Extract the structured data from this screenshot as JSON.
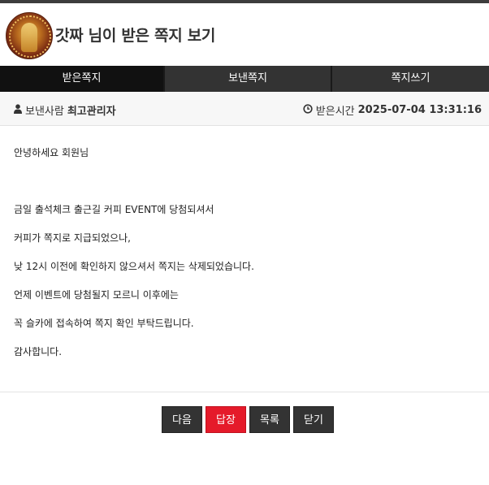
{
  "header": {
    "title": "갓짜 님이 받은 쪽지 보기",
    "avatar": "profile-avatar"
  },
  "tabs": [
    {
      "label": "받은쪽지",
      "active": true
    },
    {
      "label": "보낸쪽지",
      "active": false
    },
    {
      "label": "쪽지쓰기",
      "active": false
    }
  ],
  "info": {
    "sender_label": "보낸사람",
    "sender_name": "최고관리자",
    "sender_icon": "user-icon",
    "received_label": "받은시간",
    "received_time": "2025-07-04 13:31:16",
    "received_icon": "clock-icon"
  },
  "message": {
    "lines": [
      "안녕하세요 회원님",
      "금일 출석체크 출근길 커피 EVENT에 당첨되셔서",
      "커피가 쪽지로 지급되었으나,",
      "낮 12시 이전에 확인하지 않으셔서 쪽지는 삭제되었습니다.",
      "언제 이벤트에 당첨될지 모르니 이후에는",
      "꼭 슬카에 접속하여 쪽지 확인 부탁드립니다.",
      "감사합니다."
    ]
  },
  "buttons": {
    "next": "다음",
    "reply": "답장",
    "list": "목록",
    "close": "닫기"
  },
  "colors": {
    "dark": "#333333",
    "active_tab": "#111111",
    "reply_red": "#e51a2a"
  }
}
